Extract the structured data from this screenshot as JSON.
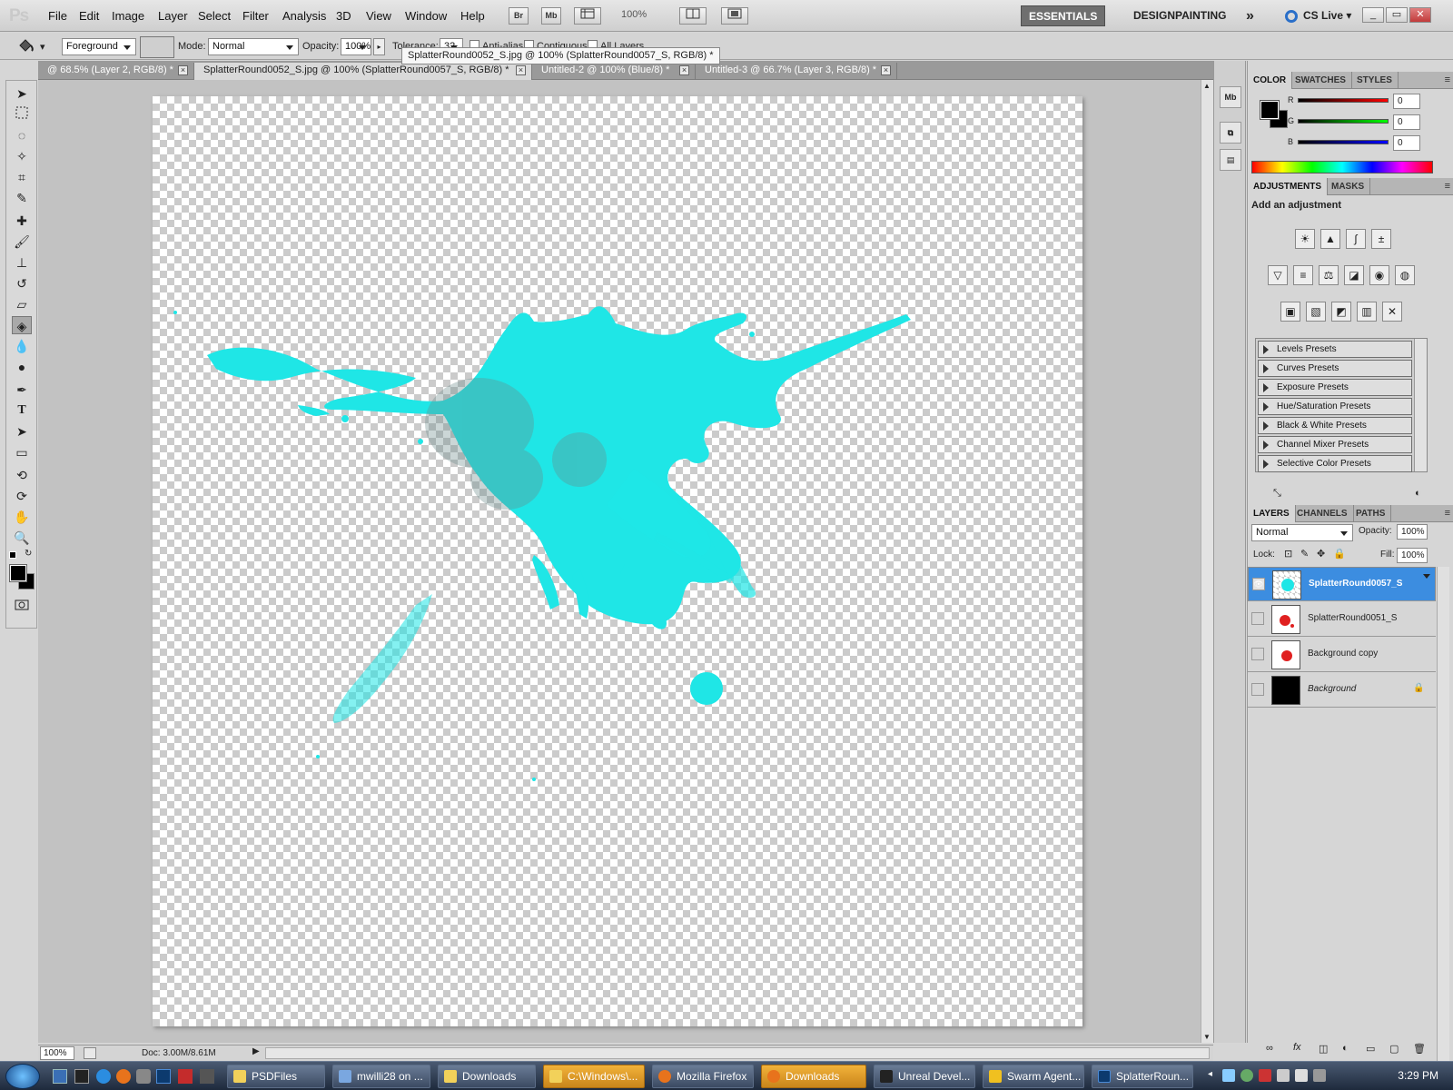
{
  "app": {
    "logo": "Ps"
  },
  "menu": [
    "File",
    "Edit",
    "Image",
    "Layer",
    "Select",
    "Filter",
    "Analysis",
    "3D",
    "View",
    "Window",
    "Help"
  ],
  "menubar_buttons": [
    "Br",
    "Mb"
  ],
  "zoom": "100%",
  "workspaces": {
    "essentials": "ESSENTIALS",
    "design": "DESIGN",
    "painting": "PAINTING",
    "more": "»",
    "cslive": "CS Live"
  },
  "options": {
    "fill_source": "Foreground",
    "mode_label": "Mode:",
    "mode_value": "Normal",
    "opacity_label": "Opacity:",
    "opacity_value": "100%",
    "tolerance_label": "Tolerance:",
    "tolerance_value": "32",
    "antialias": "Anti-alias",
    "contiguous": "Contiguous",
    "all_layers": "All Layers"
  },
  "tooltip": "SplatterRound0052_S.jpg @ 100% (SplatterRound0057_S, RGB/8) *",
  "tabs": [
    {
      "label": "@ 68.5% (Layer 2, RGB/8) *"
    },
    {
      "label": "SplatterRound0052_S.jpg @ 100% (SplatterRound0057_S, RGB/8) *"
    },
    {
      "label": "Untitled-2 @ 100% (Blue/8) *"
    },
    {
      "label": "Untitled-3 @ 66.7% (Layer 3, RGB/8) *"
    }
  ],
  "status": {
    "zoom": "100%",
    "doc": "Doc: 3.00M/8.61M"
  },
  "color_panel": {
    "tabs": [
      "COLOR",
      "SWATCHES",
      "STYLES"
    ],
    "r_label": "R",
    "g_label": "G",
    "b_label": "B",
    "r": "0",
    "g": "0",
    "b": "0"
  },
  "adjustments": {
    "tabs": [
      "ADJUSTMENTS",
      "MASKS"
    ],
    "title": "Add an adjustment",
    "presets": [
      "Levels Presets",
      "Curves Presets",
      "Exposure Presets",
      "Hue/Saturation Presets",
      "Black & White Presets",
      "Channel Mixer Presets",
      "Selective Color Presets"
    ]
  },
  "layers_panel": {
    "tabs": [
      "LAYERS",
      "CHANNELS",
      "PATHS"
    ],
    "blend": "Normal",
    "opacity_label": "Opacity:",
    "opacity": "100%",
    "lock_label": "Lock:",
    "fill_label": "Fill:",
    "fill": "100%",
    "layers": [
      {
        "name": "SplatterRound0057_S"
      },
      {
        "name": "SplatterRound0051_S"
      },
      {
        "name": "Background copy"
      },
      {
        "name": "Background"
      }
    ]
  },
  "taskbar": {
    "items": [
      "PSDFiles",
      "mwilli28 on ...",
      "Downloads",
      "C:\\Windows\\...",
      "Mozilla Firefox",
      "Downloads",
      "Unreal Devel...",
      "Swarm Agent...",
      "SplatterRoun..."
    ],
    "clock": "3:29 PM"
  },
  "colors": {
    "splatter": "#1fe6e6",
    "selected_layer": "#3c8de0"
  }
}
